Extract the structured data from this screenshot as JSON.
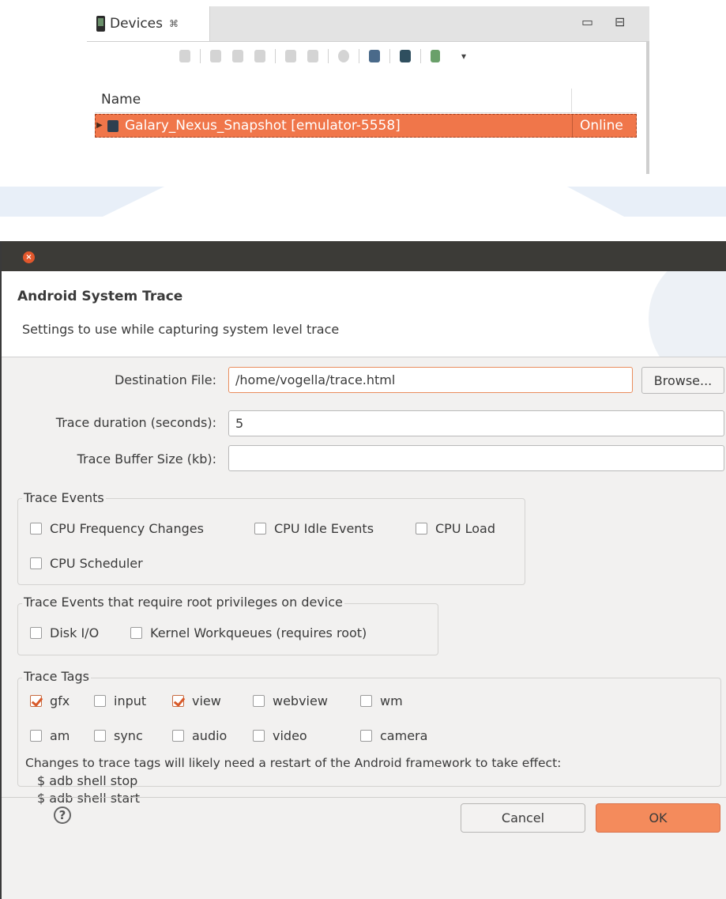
{
  "devices_view": {
    "tab_label": "Devices",
    "tab_close": "⌘",
    "minimize_glyph": "▭",
    "maximize_glyph": "⊟",
    "menu_glyph": "▾",
    "column_name": "Name",
    "row": {
      "device_name": "Galary_Nexus_Snapshot [emulator-5558]",
      "status": "Online",
      "highlight_color": "#f0764a"
    },
    "toolbar_icons": [
      "debug-icon",
      "heap-icon",
      "dump-hprof-icon",
      "gc-icon",
      "threads-icon",
      "method-profiling-icon",
      "stop-process-icon",
      "screen-capture-icon",
      "systrace-icon",
      "opengl-trace-icon",
      "view-menu-icon"
    ]
  },
  "dialog": {
    "close_glyph": "×",
    "title": "Android System Trace",
    "subtitle": "Settings to use while capturing system level trace",
    "destination_label": "Destination File:",
    "destination_value": "/home/vogella/trace.html",
    "browse_label": "Browse...",
    "duration_label": "Trace duration (seconds):",
    "duration_value": "5",
    "buffer_label": "Trace Buffer Size (kb):",
    "buffer_value": "",
    "trace_events": {
      "legend": "Trace Events",
      "items": [
        {
          "label": "CPU Frequency Changes",
          "checked": false
        },
        {
          "label": "CPU Idle Events",
          "checked": false
        },
        {
          "label": "CPU Load",
          "checked": false
        },
        {
          "label": "CPU Scheduler",
          "checked": false
        }
      ]
    },
    "root_events": {
      "legend": "Trace Events that require root privileges on device",
      "items": [
        {
          "label": "Disk I/O",
          "checked": false
        },
        {
          "label": "Kernel Workqueues (requires root)",
          "checked": false
        }
      ]
    },
    "trace_tags": {
      "legend": "Trace Tags",
      "items": [
        {
          "label": "gfx",
          "checked": true
        },
        {
          "label": "input",
          "checked": false
        },
        {
          "label": "view",
          "checked": true
        },
        {
          "label": "webview",
          "checked": false
        },
        {
          "label": "wm",
          "checked": false
        },
        {
          "label": "am",
          "checked": false
        },
        {
          "label": "sync",
          "checked": false
        },
        {
          "label": "audio",
          "checked": false
        },
        {
          "label": "video",
          "checked": false
        },
        {
          "label": "camera",
          "checked": false
        }
      ],
      "note_line1": "Changes to trace tags will likely need a restart of the Android framework to take effect:",
      "note_line2": "$ adb shell stop",
      "note_line3": "$ adb shell start"
    },
    "help_glyph": "?",
    "cancel_label": "Cancel",
    "ok_label": "OK",
    "accent_color": "#f48b5c"
  }
}
